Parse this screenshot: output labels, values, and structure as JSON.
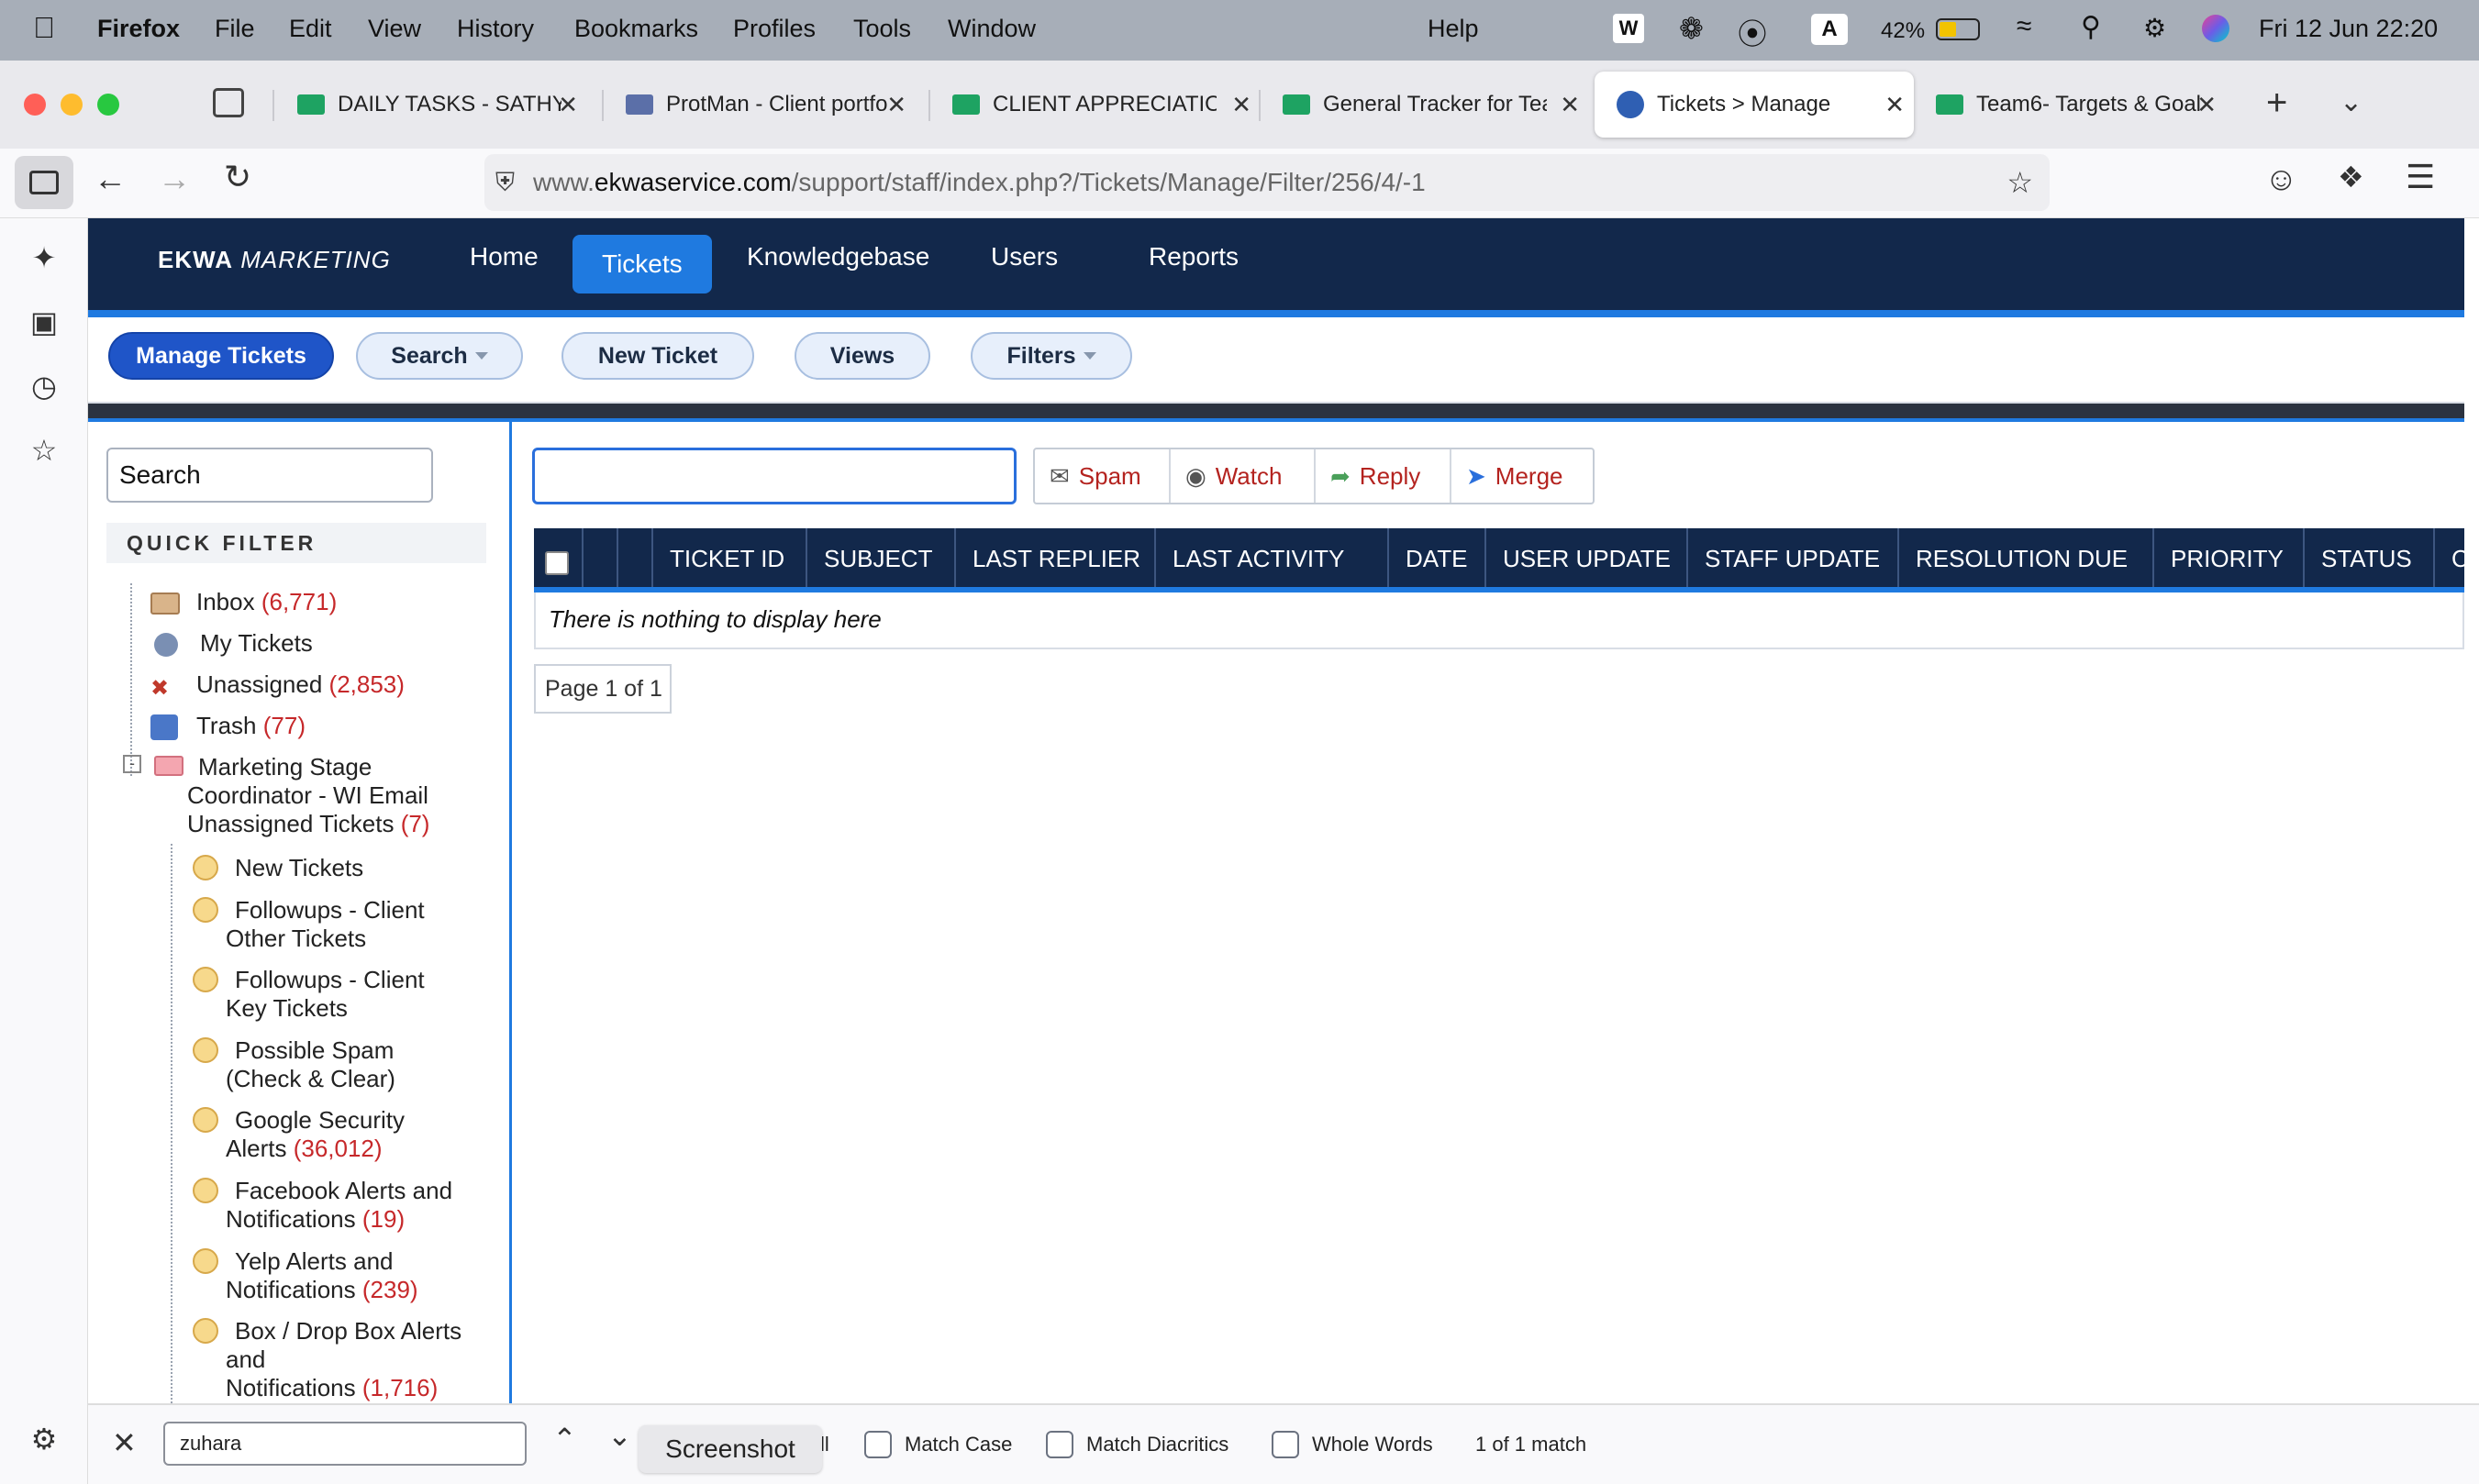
{
  "menubar": {
    "apple_icon": "apple-icon",
    "app": "Firefox",
    "items": [
      "File",
      "Edit",
      "View",
      "History",
      "Bookmarks",
      "Profiles",
      "Tools",
      "Window"
    ],
    "help": "Help",
    "battery": "42%",
    "input_source": "A",
    "datetime": "Fri 12 Jun  22:20"
  },
  "tabs": [
    {
      "label": "DAILY TASKS - SATHYA",
      "color": "#1ea362"
    },
    {
      "label": "ProtMan - Client portfo",
      "color": "#5b6fa8"
    },
    {
      "label": "CLIENT APPRECIATION",
      "color": "#1ea362"
    },
    {
      "label": "General Tracker for Tea",
      "color": "#1ea362"
    },
    {
      "label": "Tickets > Manage",
      "color": "#2f5fb3",
      "active": true
    },
    {
      "label": "Team6- Targets & Goal",
      "color": "#1ea362"
    }
  ],
  "url": {
    "prefix": "www.",
    "host": "ekwaservice.com",
    "path": "/support/staff/index.php?/Tickets/Manage/Filter/256/4/-1"
  },
  "app": {
    "logo_bold": "EKWA",
    "logo_light": "MARKETING",
    "nav": [
      "Home",
      "Tickets",
      "Knowledgebase",
      "Users",
      "Reports"
    ],
    "active_nav": "Tickets",
    "subnav": {
      "manage": "Manage Tickets",
      "search": "Search",
      "new_ticket": "New Ticket",
      "views": "Views",
      "filters": "Filters"
    }
  },
  "left": {
    "search_placeholder": "Search",
    "quick_filter": "QUICK FILTER",
    "top_items": [
      {
        "label": "Inbox",
        "count": "(6,771)",
        "icon": "inbox-icon"
      },
      {
        "label": "My Tickets",
        "count": "",
        "icon": "user-icon"
      },
      {
        "label": "Unassigned",
        "count": "(2,853)",
        "icon": "unassigned-icon"
      },
      {
        "label": "Trash",
        "count": "(77)",
        "icon": "trash-icon"
      }
    ],
    "group": {
      "label": "Marketing Stage Coordinator - WI Email Unassigned Tickets",
      "count": "(7)"
    },
    "sub_items": [
      {
        "line1": "New Tickets",
        "line2": "",
        "count": ""
      },
      {
        "line1": "Followups - Client",
        "line2": "Other Tickets",
        "count": ""
      },
      {
        "line1": "Followups - Client",
        "line2": "Key Tickets",
        "count": ""
      },
      {
        "line1": "Possible Spam",
        "line2": "(Check & Clear)",
        "count": ""
      },
      {
        "line1": "Google Security",
        "line2": "Alerts",
        "count": "(36,012)"
      },
      {
        "line1": "Facebook Alerts and",
        "line2": "Notifications",
        "count": "(19)"
      },
      {
        "line1": "Yelp Alerts and",
        "line2": "Notifications",
        "count": "(239)"
      },
      {
        "line1": "Box / Drop Box Alerts",
        "line2": "and",
        "line3": "Notifications",
        "count": "(1,716)"
      }
    ]
  },
  "main": {
    "actions": [
      "Spam",
      "Watch",
      "Reply",
      "Merge"
    ],
    "columns": [
      "TICKET ID",
      "SUBJECT",
      "LAST REPLIER",
      "LAST ACTIVITY",
      "DATE",
      "USER UPDATE",
      "STAFF UPDATE",
      "RESOLUTION DUE",
      "PRIORITY",
      "STATUS",
      "C"
    ],
    "empty": "There is nothing to display here",
    "pager": "Page 1 of 1"
  },
  "findbar": {
    "query": "zuhara",
    "partial_label": "ll",
    "match_case": "Match Case",
    "match_diacritics": "Match Diacritics",
    "whole_words": "Whole Words",
    "result": "1 of 1 match",
    "tooltip": "Screenshot"
  }
}
